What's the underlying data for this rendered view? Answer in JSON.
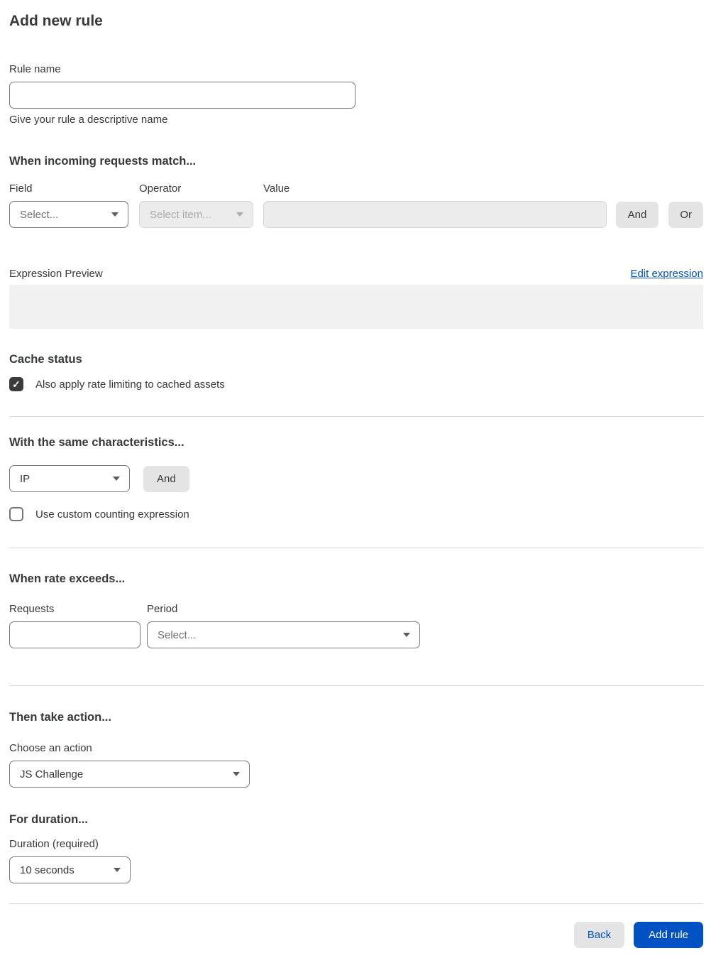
{
  "page": {
    "title": "Add new rule"
  },
  "colors": {
    "accent_blue": "#0051c3",
    "button_gray": "#e4e4e4",
    "checkbox_dark": "#3b3b3b",
    "preview_gray": "#f1f1f1",
    "divider_gray": "#d9d9d9"
  },
  "rule_name": {
    "label": "Rule name",
    "value": "",
    "helper": "Give your rule a descriptive name"
  },
  "match": {
    "heading": "When incoming requests match...",
    "field_label": "Field",
    "field_value": "Select...",
    "operator_label": "Operator",
    "operator_value": "Select item...",
    "operator_disabled": true,
    "value_label": "Value",
    "value_text": "",
    "value_disabled": true,
    "and_label": "And",
    "or_label": "Or"
  },
  "expression": {
    "label": "Expression Preview",
    "edit_link": "Edit expression",
    "preview_text": ""
  },
  "cache": {
    "heading": "Cache status",
    "checkbox_label": "Also apply rate limiting to cached assets",
    "checked": true,
    "check_icon": "✓"
  },
  "characteristics": {
    "heading": "With the same characteristics...",
    "select_value": "IP",
    "and_label": "And",
    "checkbox_label": "Use custom counting expression",
    "checked": false
  },
  "rate": {
    "heading": "When rate exceeds...",
    "requests_label": "Requests",
    "requests_value": "",
    "period_label": "Period",
    "period_value": "Select..."
  },
  "action": {
    "heading": "Then take action...",
    "label": "Choose an action",
    "value": "JS Challenge"
  },
  "duration": {
    "heading": "For duration...",
    "label": "Duration (required)",
    "value": "10 seconds"
  },
  "footer": {
    "back_label": "Back",
    "add_rule_label": "Add rule"
  }
}
